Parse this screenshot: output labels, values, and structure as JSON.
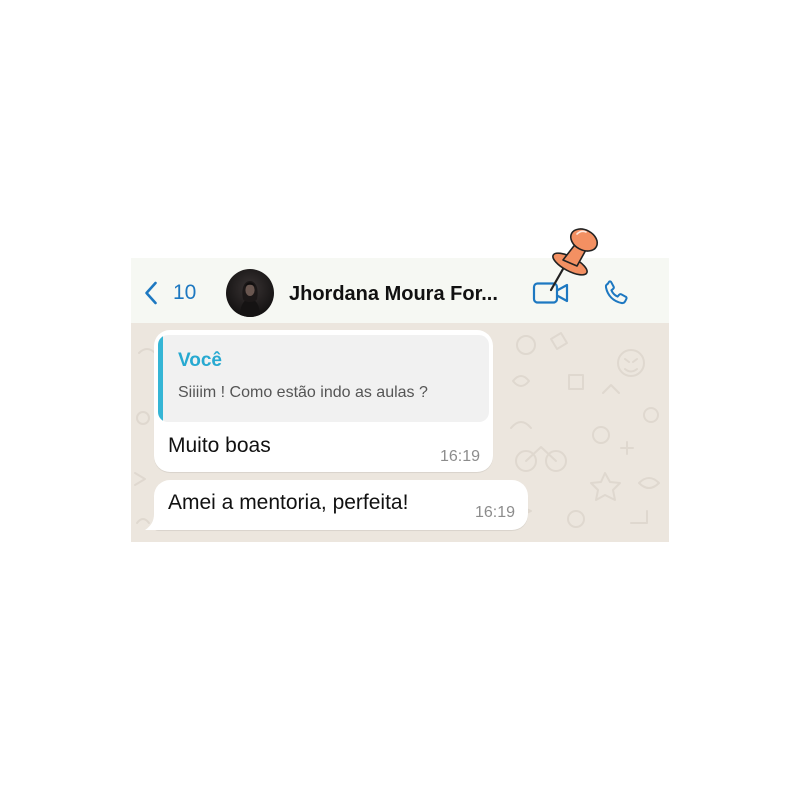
{
  "header": {
    "back_icon": "chevron-left-icon",
    "unread_count": "10",
    "contact_name": "Jhordana Moura For...",
    "video_call_icon": "video-camera-icon",
    "voice_call_icon": "phone-icon"
  },
  "sticker": {
    "icon": "pushpin-icon"
  },
  "messages": [
    {
      "direction": "incoming",
      "quote": {
        "author": "Você",
        "text": "Siiiim ! Como estão indo as aulas ?"
      },
      "text": "Muito boas",
      "time": "16:19"
    },
    {
      "direction": "incoming",
      "text": "Amei a mentoria, perfeita!",
      "time": "16:19"
    }
  ],
  "colors": {
    "accent": "#1d78c1",
    "quote_author": "#27a9d1",
    "quote_bar": "#35b5d5",
    "header_bg": "#f6f8f3",
    "chat_bg": "#ece6de",
    "bubble": "#ffffff",
    "timestamp": "#8c8c8c",
    "pin": "#f39062"
  }
}
